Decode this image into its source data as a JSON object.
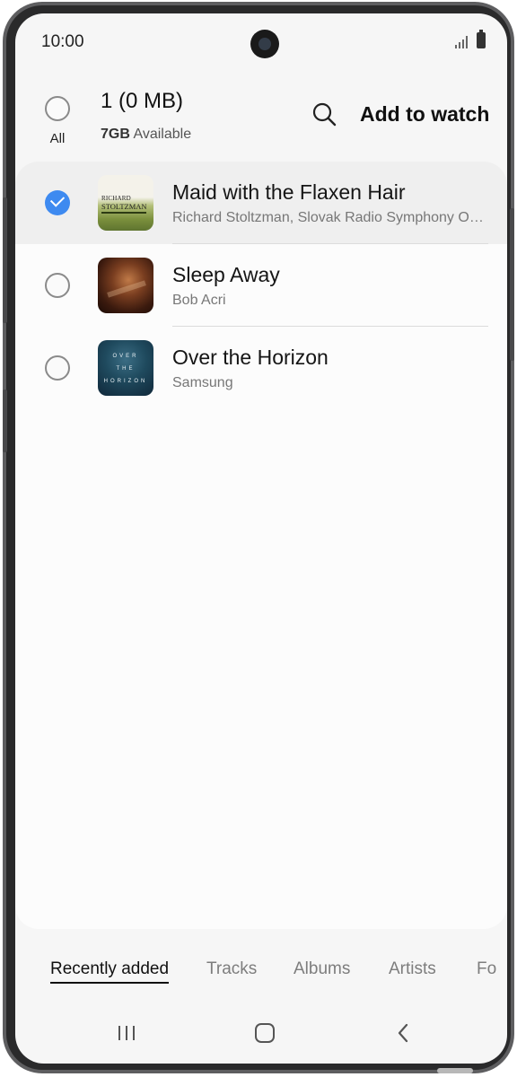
{
  "status_bar": {
    "time": "10:00",
    "icons": [
      "signal-icon",
      "battery-icon"
    ]
  },
  "header": {
    "select_all_label": "All",
    "selection_count": "1 (0 MB)",
    "storage_size": "7GB",
    "storage_suffix": "Available",
    "search_icon": "search-icon",
    "add_to_watch_label": "Add to watch"
  },
  "tracks": [
    {
      "title": "Maid with the Flaxen Hair",
      "artist": "Richard Stoltzman, Slovak Radio Symphony Orchestra",
      "selected": true,
      "art_line1": "RICHARD",
      "art_line2": "STOLTZMAN"
    },
    {
      "title": "Sleep Away",
      "artist": "Bob Acri",
      "selected": false
    },
    {
      "title": "Over the Horizon",
      "artist": "Samsung",
      "selected": false,
      "art_words": [
        "OVER",
        "THE",
        "HORIZON"
      ]
    }
  ],
  "tabs": [
    "Recently added",
    "Tracks",
    "Albums",
    "Artists",
    "Fo"
  ],
  "active_tab": "Recently added",
  "nav": [
    "recent-apps-icon",
    "home-icon",
    "back-icon"
  ],
  "colors": {
    "accent": "#3e8af0",
    "background": "#f6f6f6"
  }
}
